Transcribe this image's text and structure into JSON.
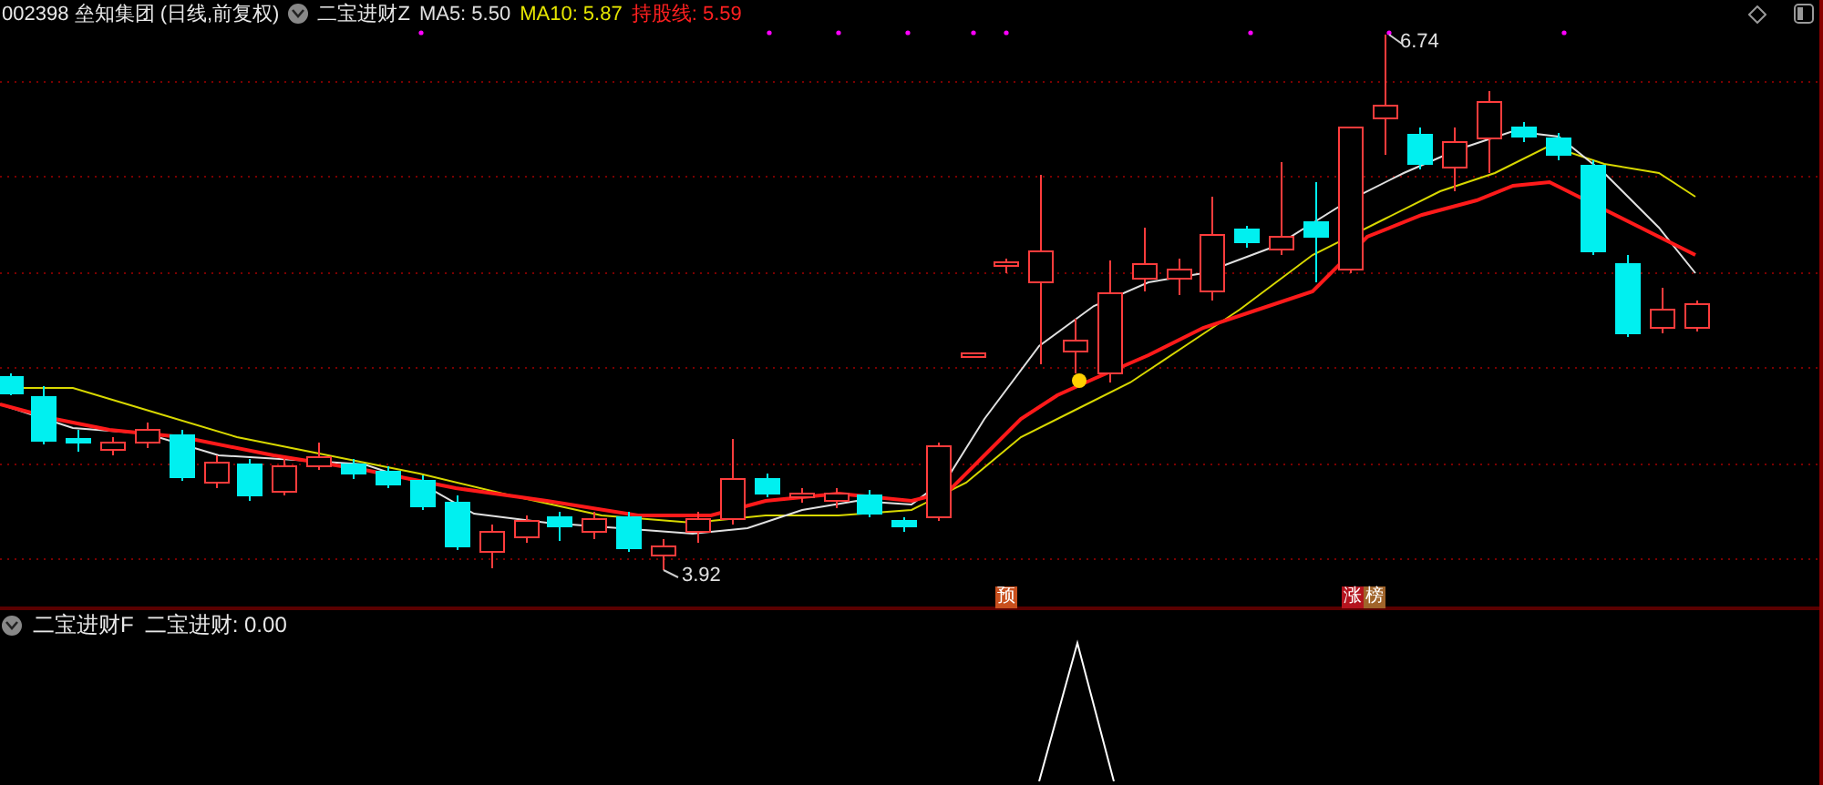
{
  "header": {
    "title": "002398 垒知集团 (日线,前复权)",
    "indicator": "二宝进财Z",
    "legend": [
      {
        "text": "MA5: 5.50",
        "color": "#e0e0e0"
      },
      {
        "text": "MA10: 5.87",
        "color": "#e6e600"
      },
      {
        "text": "持股线: 5.59",
        "color": "#ff2020"
      }
    ]
  },
  "price_labels": [
    {
      "text": "6.74"
    },
    {
      "text": "3.92"
    }
  ],
  "badges": [
    {
      "text": "预",
      "color": "#c8501e"
    },
    {
      "text": "涨",
      "color": "#b4141e"
    },
    {
      "text": "榜",
      "color": "#a0642a"
    }
  ],
  "lower_panel": {
    "indicator": "二宝进财F",
    "reading": "二宝进财: 0.00"
  }
}
